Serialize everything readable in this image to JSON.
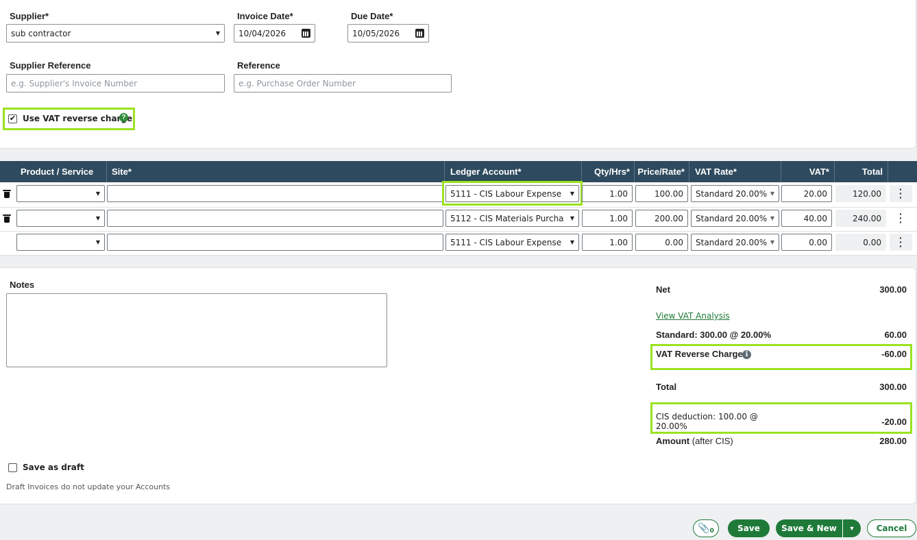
{
  "header": {
    "supplier_label": "Supplier*",
    "supplier_value": "sub contractor",
    "invoice_date_label": "Invoice Date*",
    "invoice_date_value": "10/04/2026",
    "due_date_label": "Due Date*",
    "due_date_value": "10/05/2026",
    "supplier_ref_label": "Supplier Reference",
    "supplier_ref_placeholder": "e.g. Supplier's Invoice Number",
    "reference_label": "Reference",
    "reference_placeholder": "e.g. Purchase Order Number",
    "vat_reverse_label": "Use VAT reverse charge",
    "vat_reverse_checked": true,
    "help_glyph": "?"
  },
  "table": {
    "columns": {
      "product": "Product / Service",
      "site": "Site*",
      "ledger": "Ledger Account*",
      "qty": "Qty/Hrs*",
      "price": "Price/Rate*",
      "vat_rate": "VAT Rate*",
      "vat": "VAT*",
      "total": "Total"
    },
    "rows": [
      {
        "product": "",
        "site": "",
        "ledger": "5111 - CIS Labour Expense",
        "qty": "1.00",
        "price": "100.00",
        "vat_rate": "Standard 20.00%",
        "vat": "20.00",
        "total": "120.00"
      },
      {
        "product": "",
        "site": "",
        "ledger": "5112 - CIS Materials Purcha",
        "qty": "1.00",
        "price": "200.00",
        "vat_rate": "Standard 20.00%",
        "vat": "40.00",
        "total": "240.00"
      },
      {
        "product": "",
        "site": "",
        "ledger": "5111 - CIS Labour Expense",
        "qty": "1.00",
        "price": "0.00",
        "vat_rate": "Standard 20.00%",
        "vat": "0.00",
        "total": "0.00"
      }
    ]
  },
  "notes": {
    "label": "Notes",
    "value": ""
  },
  "summary": {
    "net_label": "Net",
    "net_value": "300.00",
    "vat_analysis_link": "View VAT Analysis",
    "standard_label": "Standard: 300.00 @ 20.00%",
    "standard_value": "60.00",
    "reverse_label": "VAT Reverse Charge",
    "reverse_value": "-60.00",
    "info_glyph": "i",
    "total_label": "Total",
    "total_value": "300.00",
    "cis_label_line1": "CIS deduction: 100.00 @",
    "cis_label_line2": "20.00%",
    "cis_value": "-20.00",
    "amount_label": "Amount",
    "amount_suffix": "(after CIS)",
    "amount_value": "280.00"
  },
  "draft": {
    "label": "Save as draft",
    "checked": false,
    "hint": "Draft Invoices do not update your Accounts"
  },
  "actions": {
    "attach_count": "0",
    "save": "Save",
    "save_new": "Save & New",
    "cancel": "Cancel"
  },
  "colors": {
    "primary": "#1f7a3a",
    "highlight": "#9be21f",
    "table_header": "#2e4a5e"
  }
}
